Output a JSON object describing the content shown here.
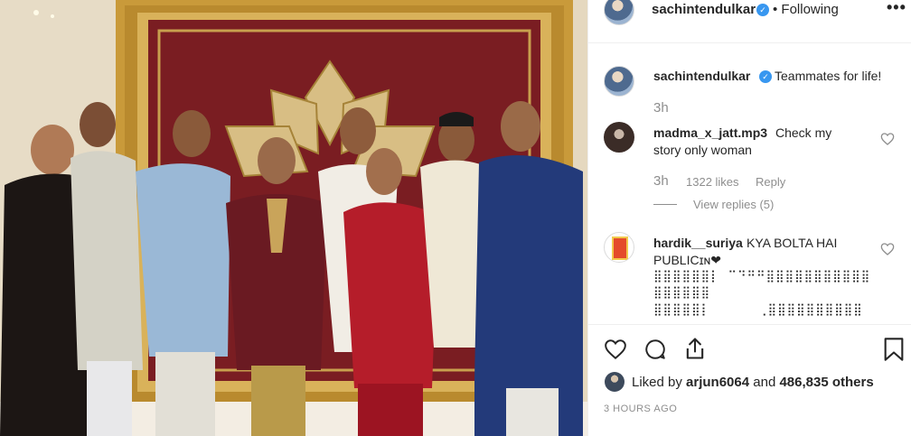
{
  "post": {
    "author": "sachintendulkar",
    "follow_status": "• Following",
    "more_icon": "ellipsis-icon"
  },
  "caption": {
    "username": "sachintendulkar",
    "text": "Teammates for life!",
    "age": "3h"
  },
  "comments": [
    {
      "username": "madma_x_jatt.mp3",
      "text_line1": "Check my",
      "text_line2": "story only woman",
      "age": "3h",
      "likes": "1322 likes",
      "reply_label": "Reply",
      "view_replies": "View replies (5)"
    },
    {
      "username": "hardik__suriya",
      "text_line1": "KYA BOLTA HAI",
      "text_line2": "PUBLICɪɴ❤",
      "garbled_line1": "⣿⣿⣿⣿⣿⣿⡇ ⠉⠙⠛⠛⣿⣿⣿⣿⣿⣿⣿⣿⣿⣿⣿",
      "garbled_line2": "⣿⣿⣿⣿⣿⣿",
      "garbled_line3": "⣿⣿⣿⣿⣿⡇      ⢀⣿⣿⣿⣿⣿⣿⣿⣿⣿⣿"
    }
  ],
  "footer": {
    "liked_by_prefix": "Liked by",
    "liked_by_user": "arjun6064",
    "liked_by_and": "and",
    "liked_by_count": "486,835 others",
    "timestamp": "3 HOURS AGO"
  },
  "colors": {
    "verified_blue": "#3897f0",
    "text_primary": "#262626",
    "text_secondary": "#8e8e8e",
    "border": "#efefef"
  }
}
